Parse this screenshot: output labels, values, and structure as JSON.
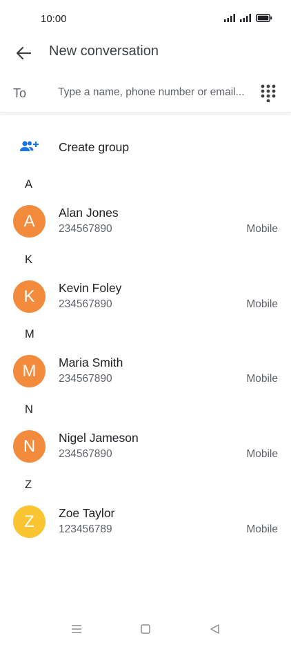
{
  "status_bar": {
    "time": "10:00",
    "icons": [
      "signal-icon",
      "signal-icon",
      "battery-icon"
    ]
  },
  "header": {
    "title": "New conversation",
    "back_icon": "arrow-back-icon"
  },
  "to_field": {
    "label": "To",
    "placeholder": "Type a name, phone number or email...",
    "value": "",
    "dialpad_icon": "dialpad-icon"
  },
  "create_group": {
    "label": "Create group",
    "icon": "group-add-icon"
  },
  "colors": {
    "accent": "#1a73e8",
    "avatar_orange": "#f28b3b",
    "avatar_yellow": "#fbc531"
  },
  "sections": [
    {
      "letter": "A",
      "contacts": [
        {
          "initial": "A",
          "name": "Alan Jones",
          "number": "234567890",
          "type": "Mobile",
          "color": "#f28b3b"
        }
      ]
    },
    {
      "letter": "K",
      "contacts": [
        {
          "initial": "K",
          "name": "Kevin Foley",
          "number": "234567890",
          "type": "Mobile",
          "color": "#f28b3b"
        }
      ]
    },
    {
      "letter": "M",
      "contacts": [
        {
          "initial": "M",
          "name": "Maria Smith",
          "number": "234567890",
          "type": "Mobile",
          "color": "#f28b3b"
        }
      ]
    },
    {
      "letter": "N",
      "contacts": [
        {
          "initial": "N",
          "name": "Nigel Jameson",
          "number": "234567890",
          "type": "Mobile",
          "color": "#f28b3b"
        }
      ]
    },
    {
      "letter": "Z",
      "contacts": [
        {
          "initial": "Z",
          "name": "Zoe Taylor",
          "number": "123456789",
          "type": "Mobile",
          "color": "#fbc531"
        }
      ]
    }
  ],
  "nav_bar": {
    "icons": [
      "menu-icon",
      "home-icon",
      "back-triangle-icon"
    ]
  }
}
